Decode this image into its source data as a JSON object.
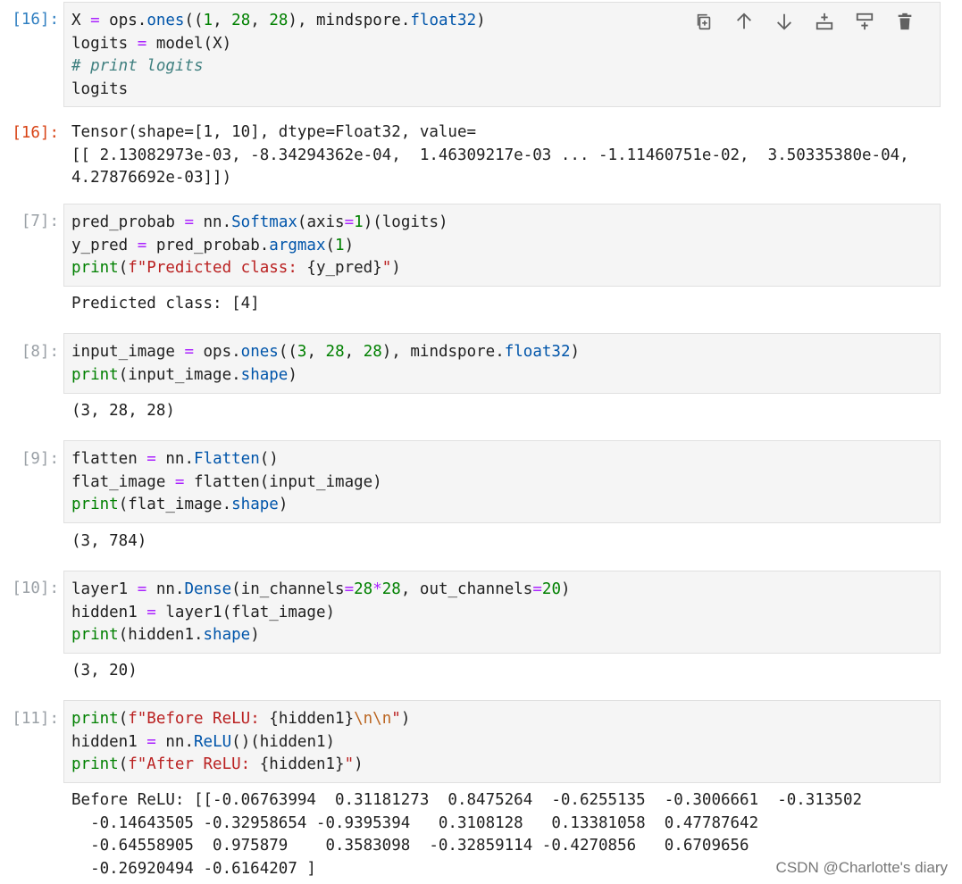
{
  "toolbar": {
    "icons": [
      "duplicate-cell-icon",
      "move-up-icon",
      "move-down-icon",
      "insert-above-icon",
      "insert-below-icon",
      "delete-icon"
    ]
  },
  "cells": [
    {
      "prompt": "[16]:",
      "code": [
        [
          {
            "t": "X "
          },
          {
            "t": "=",
            "c": "op"
          },
          {
            "t": " ops."
          },
          {
            "t": "ones",
            "c": "attr"
          },
          {
            "t": "(("
          },
          {
            "t": "1",
            "c": "nm"
          },
          {
            "t": ", "
          },
          {
            "t": "28",
            "c": "nm"
          },
          {
            "t": ", "
          },
          {
            "t": "28",
            "c": "nm"
          },
          {
            "t": "), mindspore."
          },
          {
            "t": "float32",
            "c": "attr"
          },
          {
            "t": ")"
          }
        ],
        [
          {
            "t": "logits "
          },
          {
            "t": "=",
            "c": "op"
          },
          {
            "t": " model(X)"
          }
        ],
        [
          {
            "t": "# print logits",
            "c": "cm"
          }
        ],
        [
          {
            "t": "logits"
          }
        ]
      ],
      "out_prompt": "[16]:",
      "output": [
        "Tensor(shape=[1, 10], dtype=Float32, value=",
        "[[ 2.13082973e-03, -8.34294362e-04,  1.46309217e-03 ... -1.11460751e-02,  3.50335380e-04,",
        "4.27876692e-03]])"
      ]
    },
    {
      "prompt": "[7]:",
      "code": [
        [
          {
            "t": "pred_probab "
          },
          {
            "t": "=",
            "c": "op"
          },
          {
            "t": " nn."
          },
          {
            "t": "Softmax",
            "c": "attr"
          },
          {
            "t": "(axis"
          },
          {
            "t": "=",
            "c": "op"
          },
          {
            "t": "1",
            "c": "nm"
          },
          {
            "t": ")(logits)"
          }
        ],
        [
          {
            "t": "y_pred "
          },
          {
            "t": "=",
            "c": "op"
          },
          {
            "t": " pred_probab."
          },
          {
            "t": "argmax",
            "c": "attr"
          },
          {
            "t": "("
          },
          {
            "t": "1",
            "c": "nm"
          },
          {
            "t": ")"
          }
        ],
        [
          {
            "t": "print",
            "c": "kw"
          },
          {
            "t": "("
          },
          {
            "t": "f\"Predicted class: ",
            "c": "str"
          },
          {
            "t": "{y_pred}"
          },
          {
            "t": "\"",
            "c": "str"
          },
          {
            "t": ")"
          }
        ]
      ],
      "output": [
        "Predicted class: [4]"
      ]
    },
    {
      "prompt": "[8]:",
      "code": [
        [
          {
            "t": "input_image "
          },
          {
            "t": "=",
            "c": "op"
          },
          {
            "t": " ops."
          },
          {
            "t": "ones",
            "c": "attr"
          },
          {
            "t": "(("
          },
          {
            "t": "3",
            "c": "nm"
          },
          {
            "t": ", "
          },
          {
            "t": "28",
            "c": "nm"
          },
          {
            "t": ", "
          },
          {
            "t": "28",
            "c": "nm"
          },
          {
            "t": "), mindspore."
          },
          {
            "t": "float32",
            "c": "attr"
          },
          {
            "t": ")"
          }
        ],
        [
          {
            "t": "print",
            "c": "kw"
          },
          {
            "t": "(input_image."
          },
          {
            "t": "shape",
            "c": "attr"
          },
          {
            "t": ")"
          }
        ]
      ],
      "output": [
        "(3, 28, 28)"
      ]
    },
    {
      "prompt": "[9]:",
      "code": [
        [
          {
            "t": "flatten "
          },
          {
            "t": "=",
            "c": "op"
          },
          {
            "t": " nn."
          },
          {
            "t": "Flatten",
            "c": "attr"
          },
          {
            "t": "()"
          }
        ],
        [
          {
            "t": "flat_image "
          },
          {
            "t": "=",
            "c": "op"
          },
          {
            "t": " flatten(input_image)"
          }
        ],
        [
          {
            "t": "print",
            "c": "kw"
          },
          {
            "t": "(flat_image."
          },
          {
            "t": "shape",
            "c": "attr"
          },
          {
            "t": ")"
          }
        ]
      ],
      "output": [
        "(3, 784)"
      ]
    },
    {
      "prompt": "[10]:",
      "code": [
        [
          {
            "t": "layer1 "
          },
          {
            "t": "=",
            "c": "op"
          },
          {
            "t": " nn."
          },
          {
            "t": "Dense",
            "c": "attr"
          },
          {
            "t": "(in_channels"
          },
          {
            "t": "=",
            "c": "op"
          },
          {
            "t": "28",
            "c": "nm"
          },
          {
            "t": "*",
            "c": "op"
          },
          {
            "t": "28",
            "c": "nm"
          },
          {
            "t": ", out_channels"
          },
          {
            "t": "=",
            "c": "op"
          },
          {
            "t": "20",
            "c": "nm"
          },
          {
            "t": ")"
          }
        ],
        [
          {
            "t": "hidden1 "
          },
          {
            "t": "=",
            "c": "op"
          },
          {
            "t": " layer1(flat_image)"
          }
        ],
        [
          {
            "t": "print",
            "c": "kw"
          },
          {
            "t": "(hidden1."
          },
          {
            "t": "shape",
            "c": "attr"
          },
          {
            "t": ")"
          }
        ]
      ],
      "output": [
        "(3, 20)"
      ]
    },
    {
      "prompt": "[11]:",
      "code": [
        [
          {
            "t": "print",
            "c": "kw"
          },
          {
            "t": "("
          },
          {
            "t": "f\"Before ReLU: ",
            "c": "str"
          },
          {
            "t": "{hidden1}"
          },
          {
            "t": "\\n\\n",
            "c": "esc"
          },
          {
            "t": "\"",
            "c": "str"
          },
          {
            "t": ")"
          }
        ],
        [
          {
            "t": "hidden1 "
          },
          {
            "t": "=",
            "c": "op"
          },
          {
            "t": " nn."
          },
          {
            "t": "ReLU",
            "c": "attr"
          },
          {
            "t": "()(hidden1)"
          }
        ],
        [
          {
            "t": "print",
            "c": "kw"
          },
          {
            "t": "("
          },
          {
            "t": "f\"After ReLU: ",
            "c": "str"
          },
          {
            "t": "{hidden1}"
          },
          {
            "t": "\"",
            "c": "str"
          },
          {
            "t": ")"
          }
        ]
      ],
      "output": [
        "Before ReLU: [[-0.06763994  0.31181273  0.8475264  -0.6255135  -0.3006661  -0.313502",
        "  -0.14643505 -0.32958654 -0.9395394   0.3108128   0.13381058  0.47787642",
        "  -0.64558905  0.975879    0.3583098  -0.32859114 -0.4270856   0.6709656",
        "  -0.26920494 -0.6164207 ]"
      ]
    }
  ],
  "watermark": "CSDN @Charlotte's diary"
}
